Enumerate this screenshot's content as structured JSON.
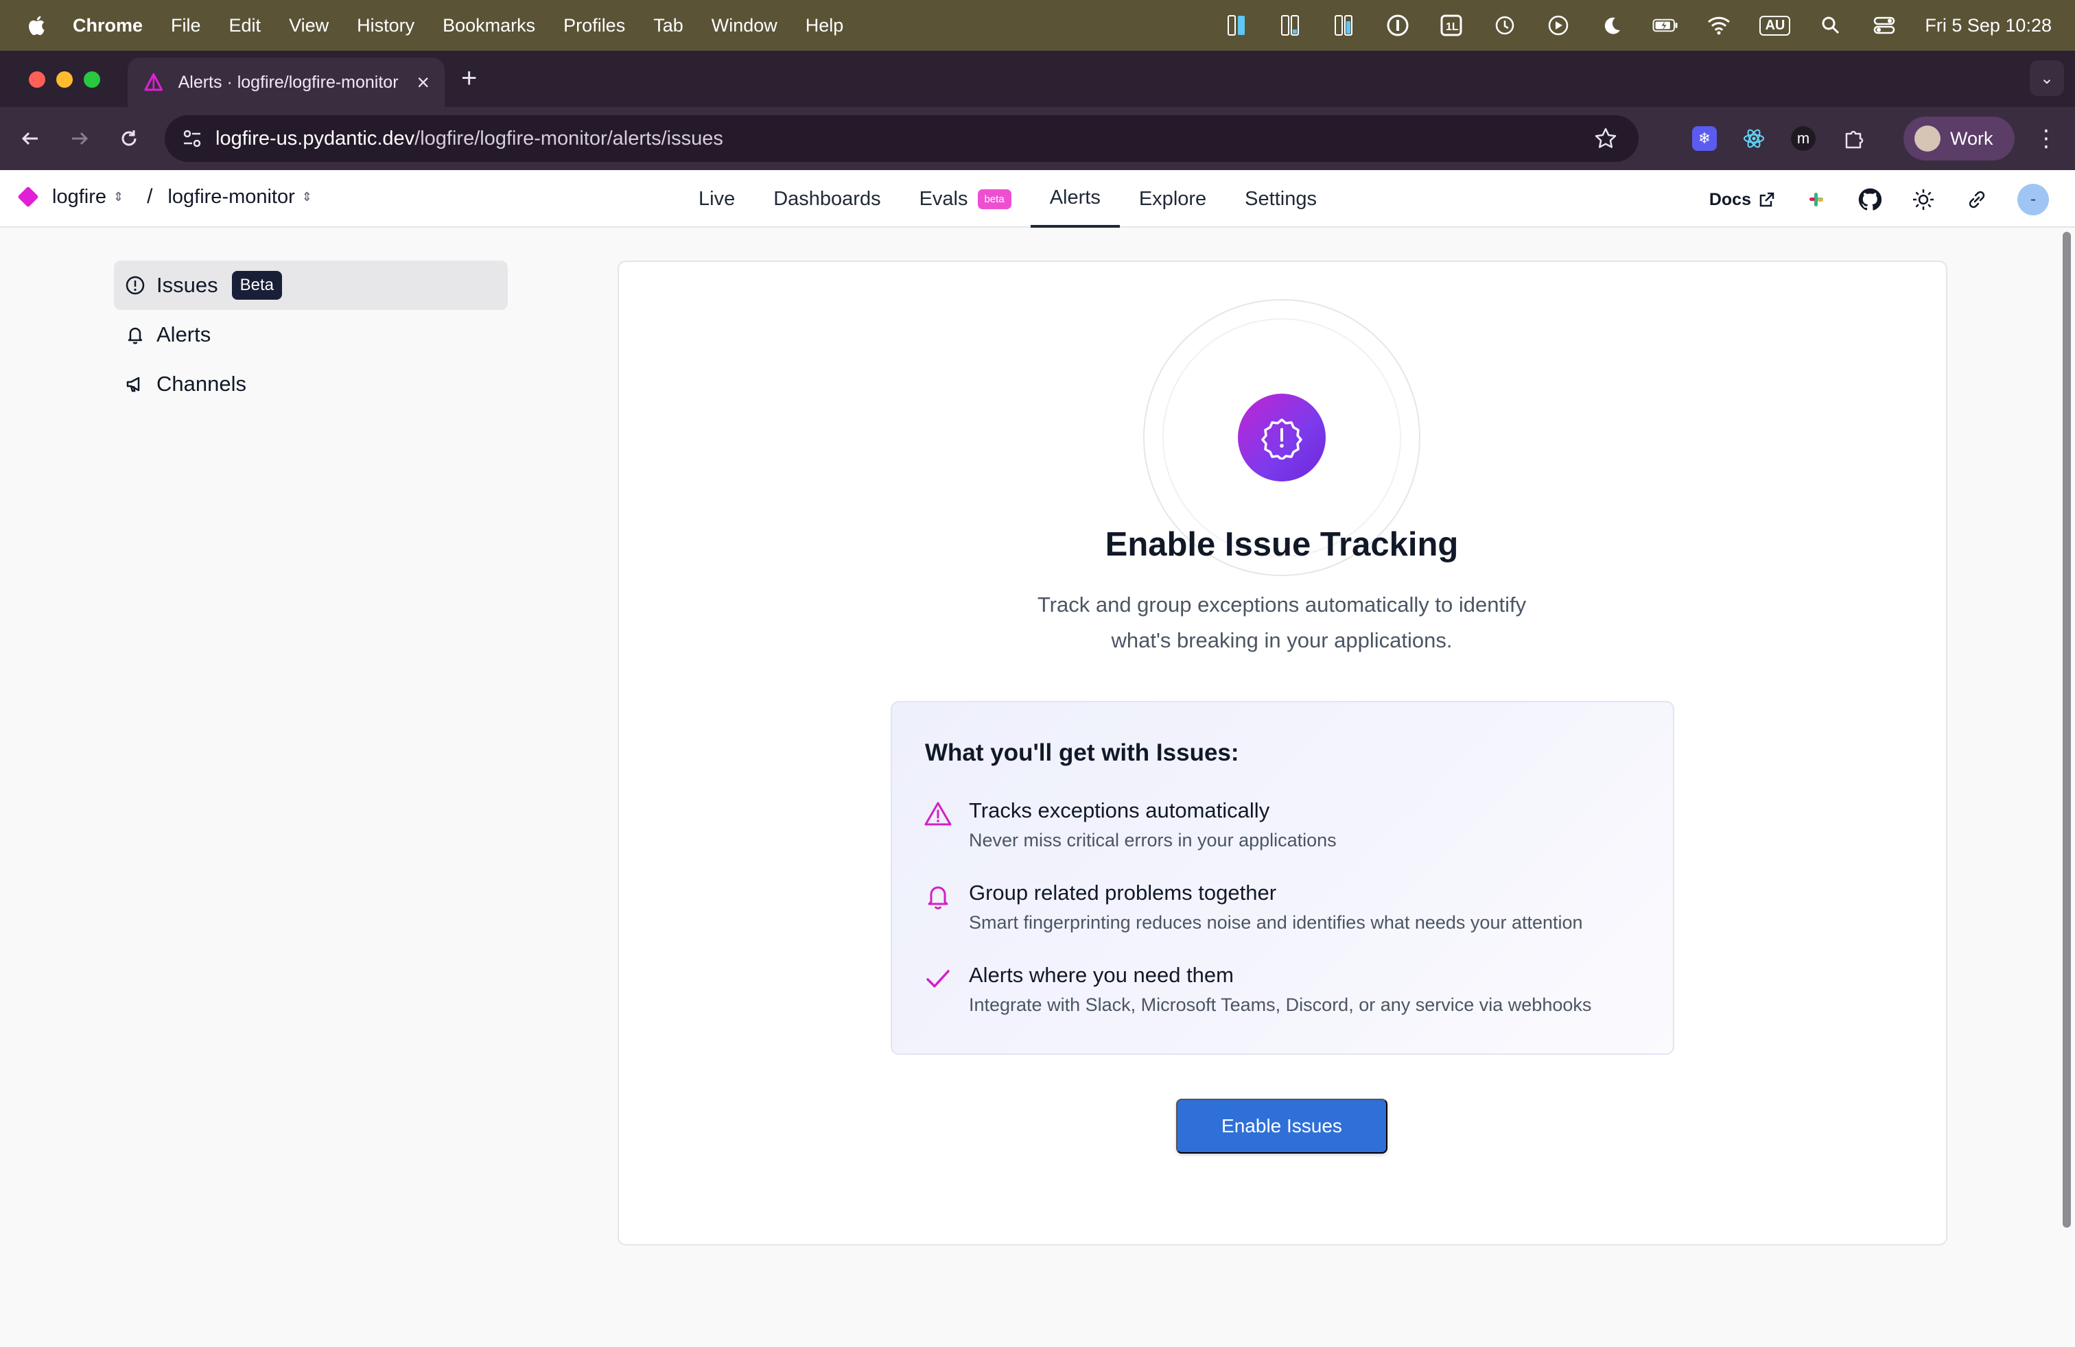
{
  "menubar": {
    "app_name": "Chrome",
    "items": [
      "File",
      "Edit",
      "View",
      "History",
      "Bookmarks",
      "Profiles",
      "Tab",
      "Window",
      "Help"
    ],
    "keyboard_layout": "AU",
    "clock": "Fri 5 Sep  10:28"
  },
  "browser": {
    "tab_title": "Alerts · logfire/logfire-monitor",
    "url_host": "logfire-us.pydantic.dev",
    "url_path": "/logfire/logfire-monitor/alerts/issues",
    "profile_name": "Work",
    "extension_m_label": "m"
  },
  "app": {
    "org": "logfire",
    "project": "logfire-monitor",
    "separator": "/",
    "nav": [
      {
        "label": "Live"
      },
      {
        "label": "Dashboards"
      },
      {
        "label": "Evals",
        "badge": "beta"
      },
      {
        "label": "Alerts",
        "active": true
      },
      {
        "label": "Explore"
      },
      {
        "label": "Settings"
      }
    ],
    "docs_label": "Docs",
    "user_initial": "-"
  },
  "sidebar": {
    "items": [
      {
        "label": "Issues",
        "badge": "Beta",
        "icon": "alert-circle-icon",
        "active": true
      },
      {
        "label": "Alerts",
        "icon": "bell-icon"
      },
      {
        "label": "Channels",
        "icon": "megaphone-icon"
      }
    ]
  },
  "main": {
    "title": "Enable Issue Tracking",
    "subtitle_line1": "Track and group exceptions automatically to identify",
    "subtitle_line2": "what's breaking in your applications.",
    "features_heading": "What you'll get with Issues:",
    "features": [
      {
        "icon": "warning-triangle-icon",
        "title": "Tracks exceptions automatically",
        "desc": "Never miss critical errors in your applications"
      },
      {
        "icon": "bell-icon",
        "title": "Group related problems together",
        "desc": "Smart fingerprinting reduces noise and identifies what needs your attention"
      },
      {
        "icon": "check-icon",
        "title": "Alerts where you need them",
        "desc": "Integrate with Slack, Microsoft Teams, Discord, or any service via webhooks"
      }
    ],
    "cta_label": "Enable Issues"
  },
  "colors": {
    "accent_magenta": "#e11fd6",
    "primary_button": "#2f6fd8",
    "hero_gradient_start": "#c026d3",
    "hero_gradient_end": "#6d28d9",
    "beta_badge_dark": "#1a1f38",
    "evals_beta_pill": "#ee4fd1"
  }
}
